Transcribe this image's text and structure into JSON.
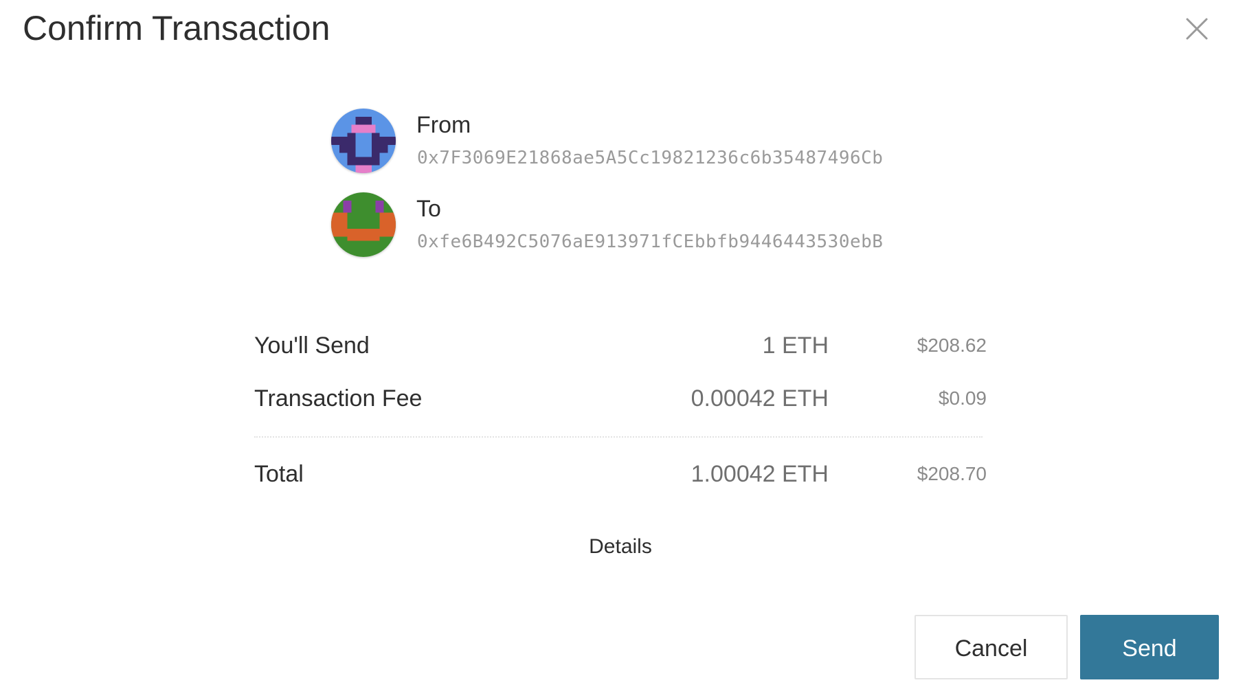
{
  "dialog": {
    "title": "Confirm Transaction",
    "close_icon": "close-icon"
  },
  "from": {
    "label": "From",
    "address": "0x7F3069E21868ae5A5Cc19821236c6b35487496Cb",
    "avatar_icon": "identicon",
    "avatar_colors": [
      "#5b94e6",
      "#3b2a6b",
      "#e67fc9"
    ]
  },
  "to": {
    "label": "To",
    "address": "0xfe6B492C5076aE913971fCEbbfb9446443530ebB",
    "avatar_icon": "identicon",
    "avatar_colors": [
      "#3e8e2e",
      "#d9622a",
      "#8b3fa8"
    ]
  },
  "summary": {
    "send": {
      "label": "You'll Send",
      "amount": "1 ETH",
      "fiat": "$208.62"
    },
    "fee": {
      "label": "Transaction Fee",
      "amount": "0.00042 ETH",
      "fiat": "$0.09"
    },
    "total": {
      "label": "Total",
      "amount": "1.00042 ETH",
      "fiat": "$208.70"
    }
  },
  "details_label": "Details",
  "buttons": {
    "cancel_label": "Cancel",
    "send_label": "Send"
  },
  "colors": {
    "accent": "#337899",
    "muted_text": "#9a9a9a"
  }
}
